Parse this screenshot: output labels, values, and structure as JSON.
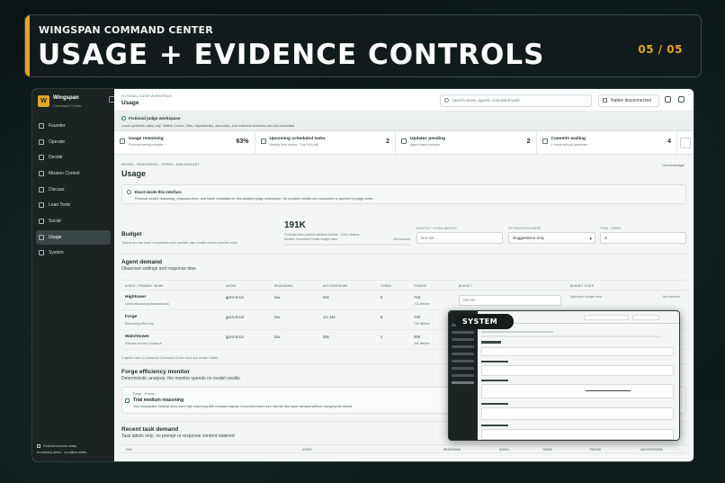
{
  "header": {
    "kicker": "WINGSPAN COMMAND CENTER",
    "title": "USAGE + EVIDENCE CONTROLS",
    "page": "05 / 05"
  },
  "sidebar": {
    "brand_name": "Wingspan",
    "brand_sub": "Command Center",
    "logo_letter": "W",
    "items": [
      {
        "label": "Founder",
        "icon": "user-icon"
      },
      {
        "label": "Operate",
        "icon": "gear-icon"
      },
      {
        "label": "Decide",
        "icon": "diamond-icon"
      },
      {
        "label": "Mission Control",
        "icon": "control-icon"
      },
      {
        "label": "Discuss",
        "icon": "chat-icon"
      },
      {
        "label": "Lean Tools",
        "icon": "tools-icon"
      },
      {
        "label": "Social",
        "icon": "share-icon"
      },
      {
        "label": "Usage",
        "icon": "chart-icon",
        "active": true
      },
      {
        "label": "System",
        "icon": "system-icon"
      }
    ],
    "footer_status": "Fictional sources ready",
    "footer_sub": "In-memory demo · no native writes"
  },
  "topbar": {
    "crumb": "FICTIONAL JUDGE WORKSPACE",
    "title": "Usage",
    "search_placeholder": "Search views, agents, scheduled work",
    "native_label": "Native disconnected"
  },
  "banner": {
    "title": "Fictional judge workspace",
    "text": "Local synthetic data only. Native Codex, files, repositories, accounts, and external services are not contacted."
  },
  "stats": [
    {
      "label": "Usage remaining",
      "sub": "Fictional weekly window",
      "value": "63%"
    },
    {
      "label": "Upcoming scheduled tasks",
      "sub": "Weekly fleet review · Tue 9:00 AM",
      "value": "2"
    },
    {
      "label": "Updates pending",
      "sub": "Agent status records",
      "value": "2"
    },
    {
      "label": "Commits waiting",
      "sub": "1 repos without upstream",
      "value": "4"
    }
  ],
  "usage": {
    "kicker": "MODEL, REASONING, SPEED, AND BUDGET",
    "title": "Usage",
    "ledger": "Live local ledger",
    "exact_title": "Exact inside this interface",
    "exact_text": "Fictional model, reasoning, response-time, and token metadata for this isolated judge workspace. No provider credits are consumed or queried in judge mode."
  },
  "budget": {
    "title": "Budget",
    "sub": "Tokens are the exact comparable unit; provider plan credits remain provider-wide.",
    "big_value": "191K",
    "big_sub": "Fictional demo period detailed tokens · 191K lifetime",
    "bar_label": "Monthly Command Center budget used",
    "bar_state": "Not reported",
    "monthly_label": "MONTHLY TOKEN BUDGET",
    "monthly_placeholder": "Not set",
    "opt_label": "OPTIMIZATION MODE",
    "opt_value": "Suggestions only",
    "trial_label": "TRIAL TURNS",
    "trial_value": "3"
  },
  "demand": {
    "title": "Agent demand",
    "sub": "Observed settings and response time",
    "headers": [
      "AGENT / PRIMARY WORK",
      "MODEL",
      "REASONING",
      "AVG RESPONSE",
      "TURNS",
      "TOKENS",
      "BUDGET",
      "BUDGET STATE"
    ],
    "rows": [
      {
        "agent": "Hightower",
        "work": "Client onboarding standard work",
        "model": "gpt-5.6-sol",
        "reasoning": "low",
        "avg": "52s",
        "turns": "6",
        "tokens": "71K",
        "tokens_sub": "71K lifetime"
      },
      {
        "agent": "Forge",
        "work": "Reasoning-effort trial",
        "model": "gpt-5.6-sol",
        "reasoning": "low",
        "avg": "1m 14s",
        "turns": "5",
        "tokens": "74K",
        "tokens_sub": "74K lifetime"
      },
      {
        "agent": "Watchtower",
        "work": "Release recovery evidence",
        "model": "gpt-5.6-sol",
        "reasoning": "low",
        "avg": "38s",
        "turns": "4",
        "tokens": "46K",
        "tokens_sub": "46K lifetime"
      }
    ],
    "budget_placeholder": "Not set",
    "budget_used_label": "Hightower budget used",
    "budget_state": "Not reported",
    "footnote": "3 agents have no measured Command Center turns and remain hidden."
  },
  "forge": {
    "title": "Forge efficiency monitor",
    "sub": "Deterministic analysis; the monitor spends no model credits",
    "box_kicker": "Forge · 4 turns",
    "box_title": "Trial medium reasoning",
    "box_text": "Your comparable fictional turns used high reasoning with compact outputs. A bounded future turn trial can test lower demand without changing the default."
  },
  "recent": {
    "title": "Recent task demand",
    "sub": "Task labels only; no prompt or response content retained",
    "headers": [
      "TASK",
      "AGENT",
      "REASONING",
      "MODEL",
      "TURNS",
      "TOKENS",
      "AVG RESPONSE"
    ]
  },
  "overlay": {
    "label": "SYSTEM"
  }
}
